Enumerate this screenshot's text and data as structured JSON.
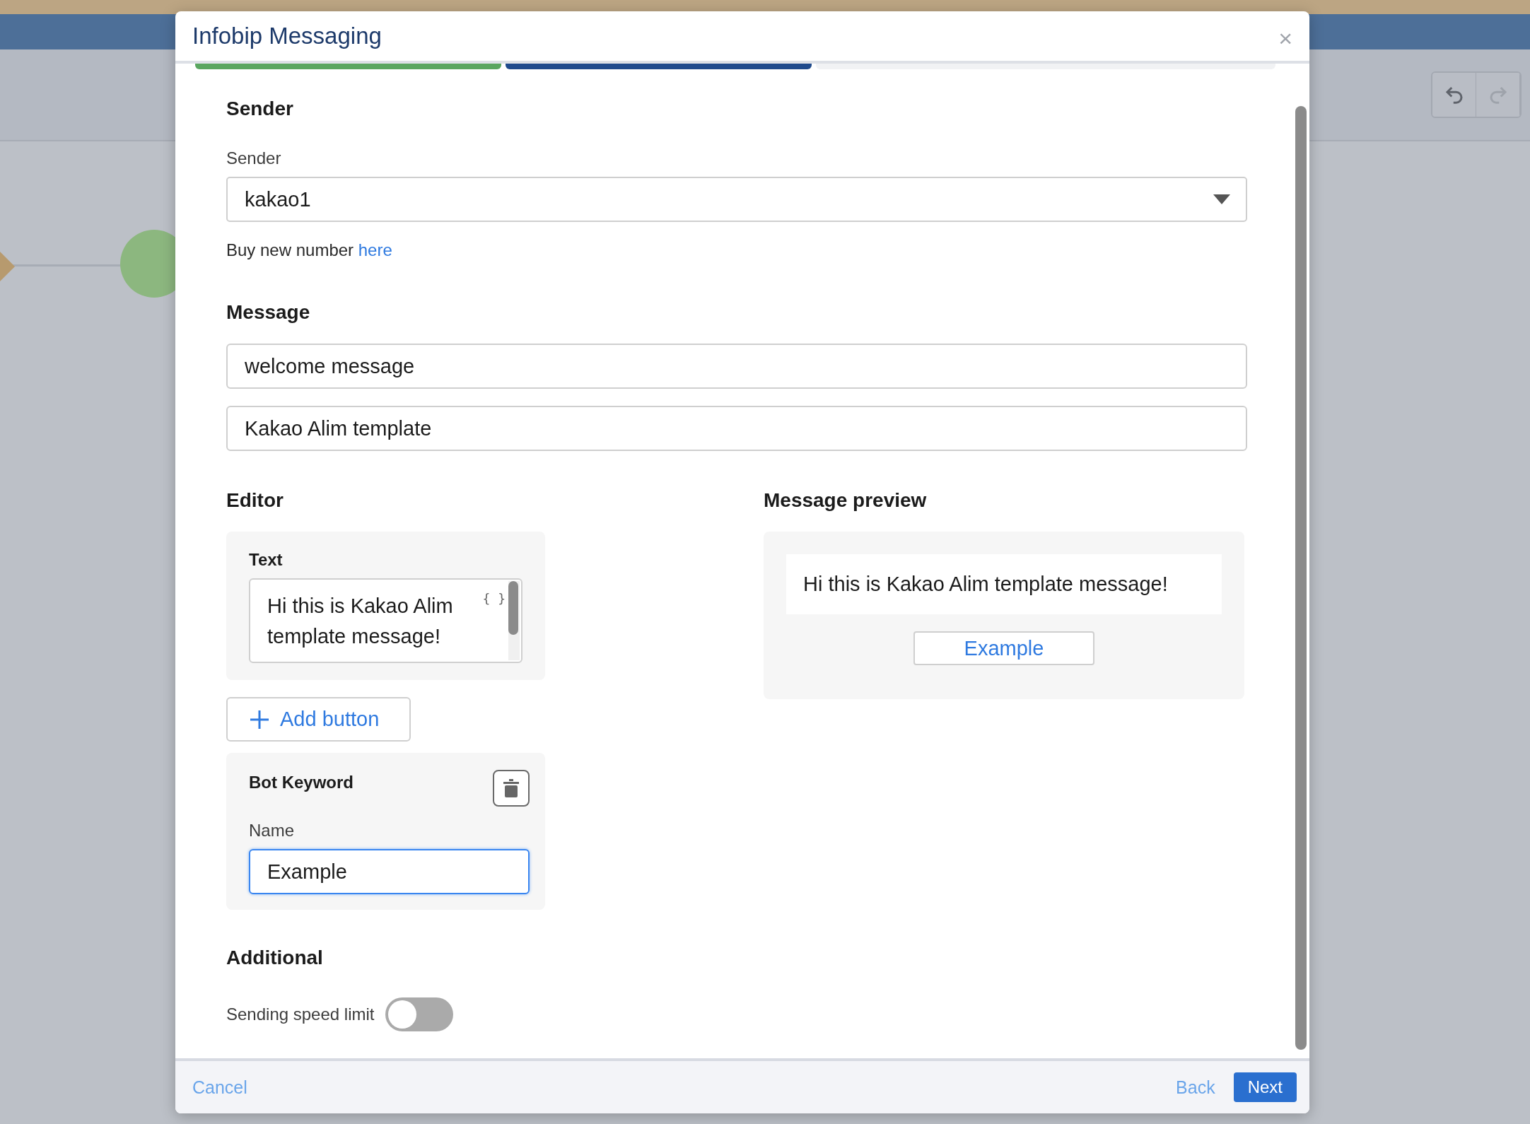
{
  "toolbar": {
    "undo": true,
    "redo": false
  },
  "modal": {
    "title": "Infobip Messaging",
    "close": "×",
    "steps": [
      {
        "kind": "done"
      },
      {
        "kind": "current"
      },
      {
        "kind": "upcoming"
      }
    ]
  },
  "sender": {
    "heading": "Sender",
    "label": "Sender",
    "value": "kakao1",
    "hint": "Buy new number",
    "link": "here"
  },
  "message": {
    "heading": "Message",
    "fields": [
      "welcome message",
      "Kakao Alim template"
    ]
  },
  "editor": {
    "heading": "Editor",
    "text_label": "Text",
    "text_value": "Hi this is Kakao Alim template message!",
    "variable_icon": "{ }",
    "add_button": "Add button",
    "bot_keyword": {
      "title": "Bot Keyword",
      "name_label": "Name",
      "name_value": "Example",
      "focused": true
    }
  },
  "preview": {
    "heading": "Message preview",
    "message": "Hi this is Kakao Alim template message!",
    "button": "Example"
  },
  "additional": {
    "heading": "Additional",
    "toggle_label": "Sending speed limit",
    "on": false
  },
  "footer": {
    "cancel": "Cancel",
    "back": "Back",
    "next": "Next"
  }
}
